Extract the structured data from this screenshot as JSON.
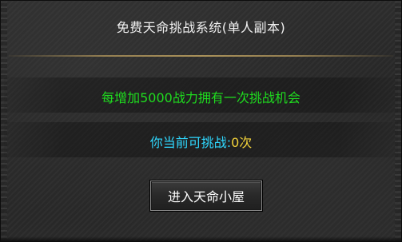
{
  "window": {
    "title": "免费天命挑战系统(单人副本)"
  },
  "info": {
    "rule_text": "每增加5000战力拥有一次挑战机会",
    "challenge_label": "你当前可挑战:",
    "challenge_count": "0次"
  },
  "actions": {
    "enter_button_label": "进入天命小屋"
  },
  "colors": {
    "rule_text": "#1fdc1f",
    "challenge_label": "#2fd8ff",
    "challenge_count": "#f2d23a",
    "divider": "#c8aa64",
    "panel_background": "#2a2a2a"
  }
}
